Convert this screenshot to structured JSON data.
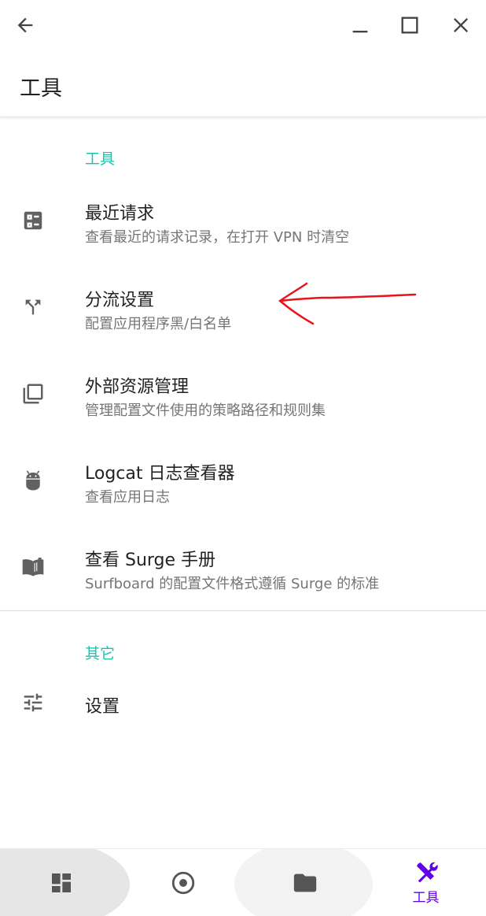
{
  "appbar": {
    "title": "工具"
  },
  "sections": [
    {
      "header": "工具"
    },
    {
      "header": "其它"
    }
  ],
  "items": [
    {
      "title": "最近请求",
      "subtitle": "查看最近的请求记录，在打开 VPN 时清空",
      "icon": "recent-requests-icon"
    },
    {
      "title": "分流设置",
      "subtitle": "配置应用程序黑/白名单",
      "icon": "call-split-icon"
    },
    {
      "title": "外部资源管理",
      "subtitle": "管理配置文件使用的策略路径和规则集",
      "icon": "library-icon"
    },
    {
      "title": "Logcat 日志查看器",
      "subtitle": "查看应用日志",
      "icon": "android-icon"
    },
    {
      "title": "查看 Surge 手册",
      "subtitle": "Surfboard 的配置文件格式遵循 Surge 的标准",
      "icon": "book-icon"
    },
    {
      "title": "设置",
      "subtitle": "",
      "icon": "tune-icon"
    }
  ],
  "bottom_nav": {
    "items": [
      {
        "icon": "dashboard-icon",
        "label": ""
      },
      {
        "icon": "radio-button-icon",
        "label": ""
      },
      {
        "icon": "folder-icon",
        "label": ""
      },
      {
        "icon": "tools-icon",
        "label": "工具",
        "selected": true
      }
    ]
  },
  "colors": {
    "accent": "#19c3b3",
    "icon": "#616161",
    "selected_nav": "#6200ee",
    "annotation": "#e8141c"
  }
}
